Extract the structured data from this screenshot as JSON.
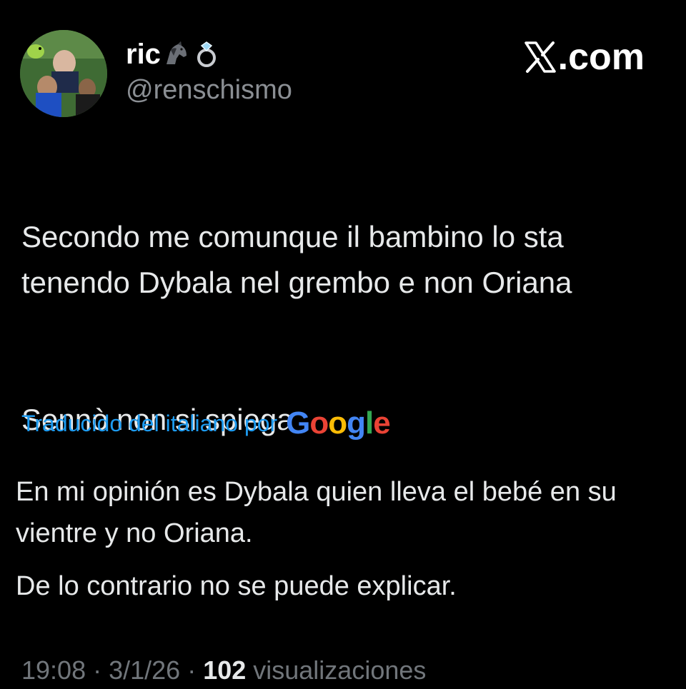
{
  "author": {
    "display_name": "ric",
    "emojis": [
      "horse-head-icon",
      "ring-icon"
    ],
    "handle": "@renschismo"
  },
  "watermark": {
    "logo": "x-logo-icon",
    "text": ".com"
  },
  "tweet": {
    "lines": [
      "Secondo me comunque il bambino lo sta tenendo Dybala nel grembo e non Oriana",
      "Sennò non si spiega"
    ]
  },
  "translation": {
    "label": "Traducido del italiano por",
    "provider": {
      "letters": [
        "G",
        "o",
        "o",
        "g",
        "l",
        "e"
      ],
      "colors": [
        "#4285f4",
        "#ea4335",
        "#fbbc05",
        "#4285f4",
        "#34a853",
        "#ea4335"
      ]
    },
    "paragraphs": [
      "En mi opinión es Dybala quien lleva el bebé en su vientre y no Oriana.",
      "De lo contrario no se puede explicar."
    ]
  },
  "meta": {
    "time": "19:08",
    "separator": " · ",
    "date": "3/1/26",
    "views_count": "102",
    "views_label": " visualizaciones"
  },
  "colors": {
    "background": "#000000",
    "text": "#e7e9ea",
    "secondary": "#71767b",
    "link": "#1d9bf0"
  }
}
